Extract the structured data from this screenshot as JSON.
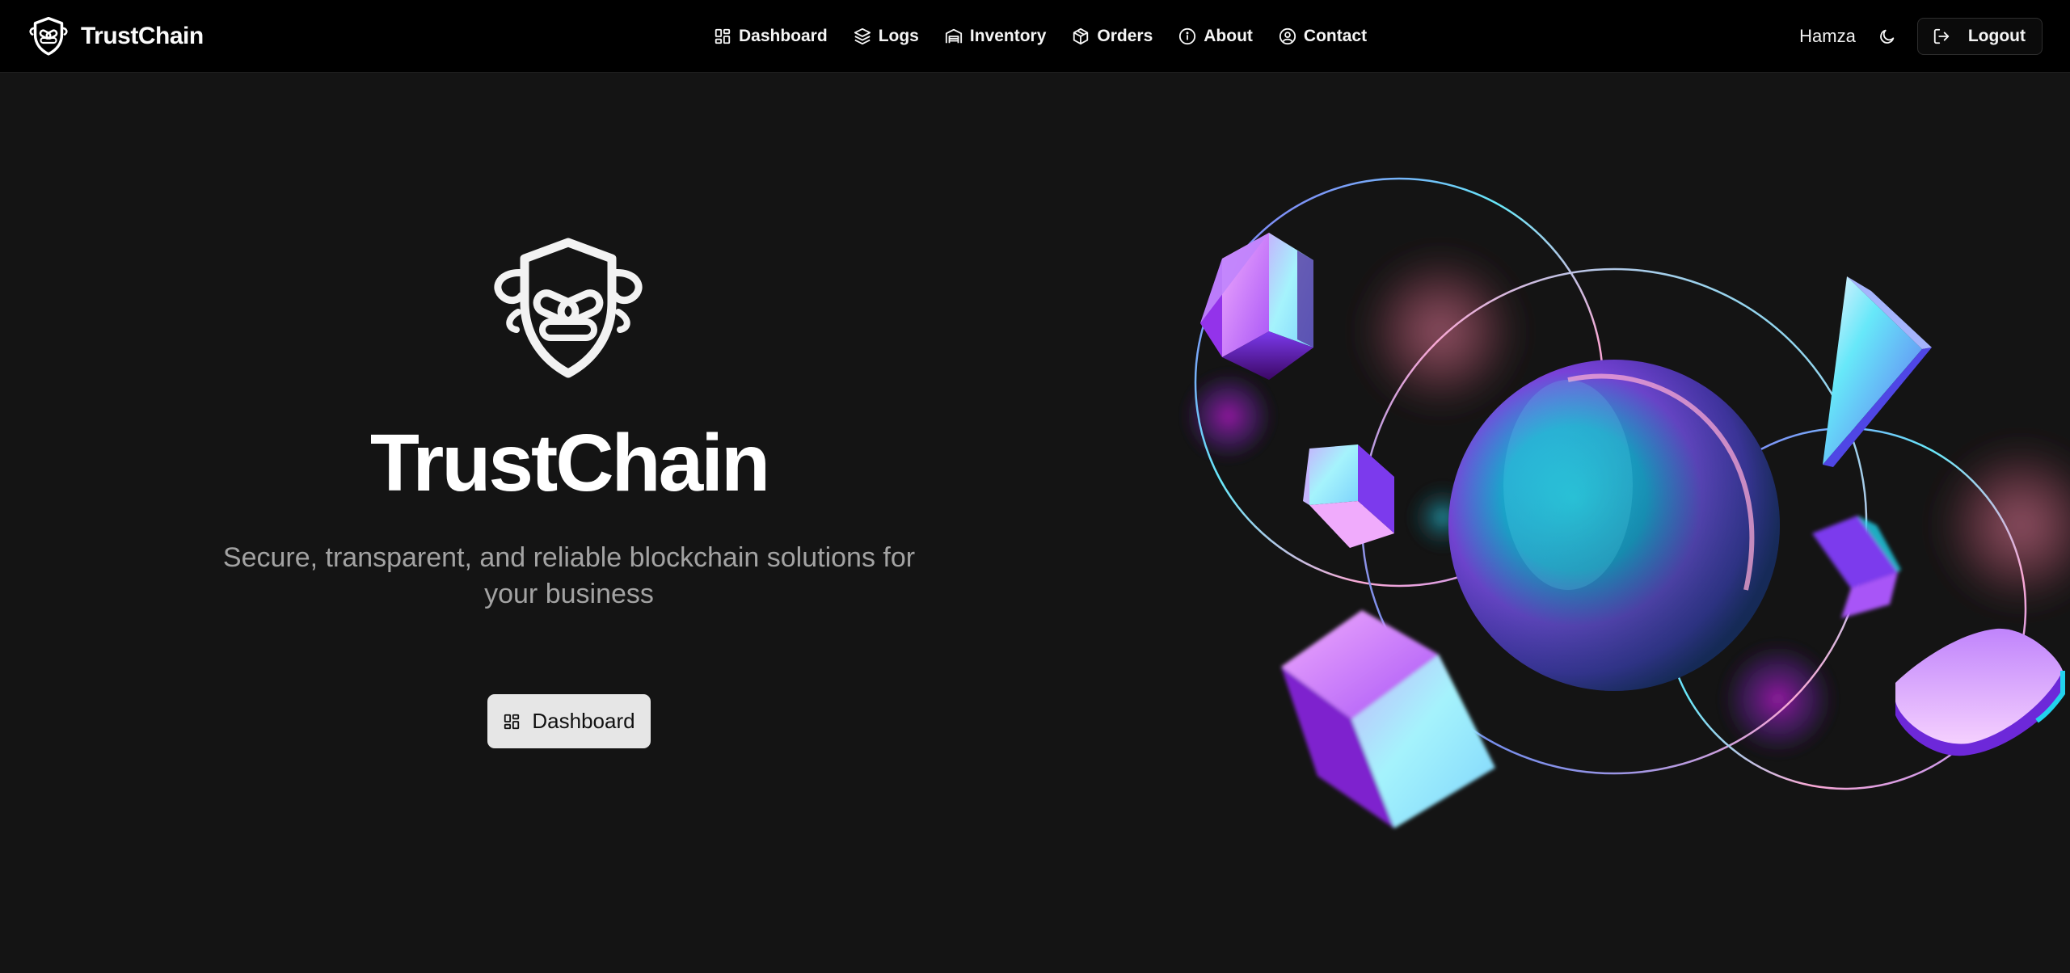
{
  "app": {
    "brand_name": "TrustChain"
  },
  "nav": {
    "links": [
      {
        "label": "Dashboard",
        "icon": "dashboard-grid-icon"
      },
      {
        "label": "Logs",
        "icon": "layers-icon"
      },
      {
        "label": "Inventory",
        "icon": "warehouse-icon"
      },
      {
        "label": "Orders",
        "icon": "package-icon"
      },
      {
        "label": "About",
        "icon": "info-icon"
      },
      {
        "label": "Contact",
        "icon": "user-circle-icon"
      }
    ]
  },
  "user": {
    "name": "Hamza",
    "theme_icon": "moon-icon",
    "logout_label": "Logout",
    "logout_icon": "logout-icon"
  },
  "hero": {
    "logo_icon": "shield-chain-icon",
    "title": "TrustChain",
    "subtitle": "Secure, transparent, and reliable blockchain solutions for your business",
    "cta_label": "Dashboard",
    "cta_icon": "dashboard-grid-icon",
    "illustration": "abstract-3d-blockchain-shapes"
  },
  "colors": {
    "nav_bg": "#000000",
    "page_bg": "#141414",
    "text_primary": "#fafafa",
    "text_muted": "#a3a3a3",
    "button_bg": "#e6e6e6",
    "accent_cyan": "#22d3ee",
    "accent_violet": "#a855f7",
    "accent_pink": "#f472b6"
  }
}
